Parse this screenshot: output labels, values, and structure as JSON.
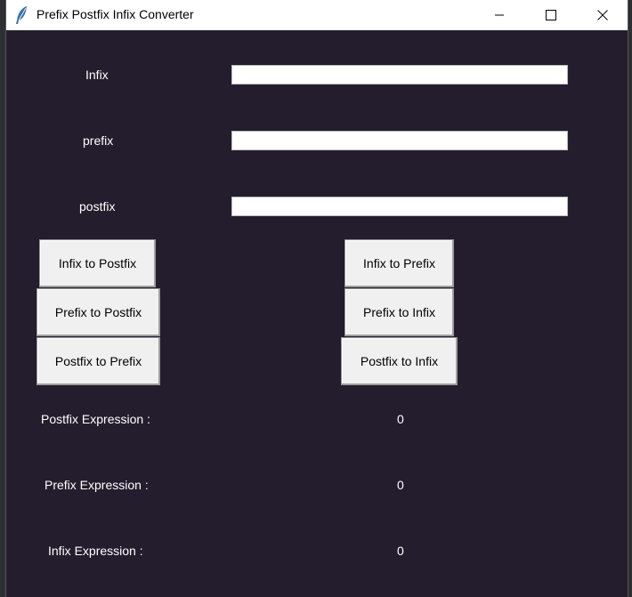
{
  "window": {
    "title": "Prefix Postfix Infix Converter",
    "icon": "feather-icon"
  },
  "inputs": {
    "infix_label": "Infix",
    "infix_value": "",
    "prefix_label": "prefix",
    "prefix_value": "",
    "postfix_label": "postfix",
    "postfix_value": ""
  },
  "buttons": {
    "infix_to_postfix": "Infix to Postfix",
    "infix_to_prefix": "Infix to Prefix",
    "prefix_to_postfix": "Prefix to Postfix",
    "prefix_to_infix": "Prefix to Infix",
    "postfix_to_prefix": "Postfix to Prefix",
    "postfix_to_infix": "Postfix to Infix"
  },
  "results": {
    "postfix_label": "Postfix Expression :",
    "postfix_value": "0",
    "prefix_label": "Prefix Expression :",
    "prefix_value": "0",
    "infix_label": "Infix Expression :",
    "infix_value": "0"
  },
  "colors": {
    "window_bg": "#241d2d",
    "button_bg": "#f0f0f0",
    "text": "#ffffff"
  }
}
